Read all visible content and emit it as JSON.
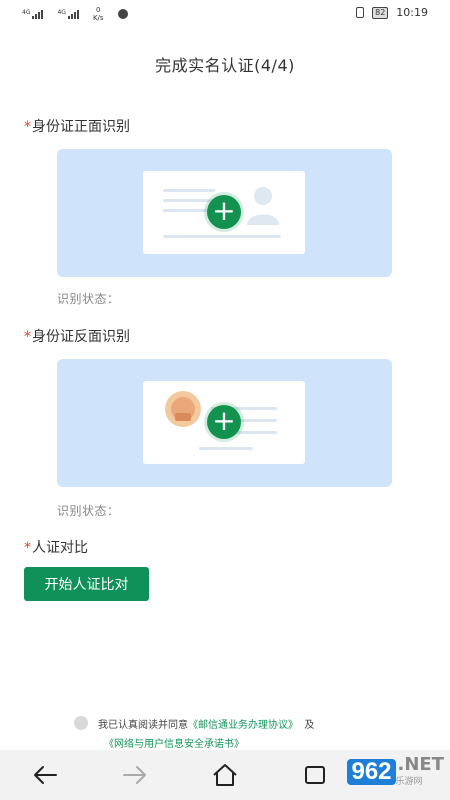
{
  "status_bar": {
    "signal1_label": "4G",
    "signal2_label": "4G",
    "speed_value": "0",
    "speed_unit": "K/s",
    "battery": "82",
    "time": "10:19"
  },
  "page": {
    "title": "完成实名认证(4/4)"
  },
  "front": {
    "star": "*",
    "label": "身份证正面识别",
    "status_label": "识别状态："
  },
  "back": {
    "star": "*",
    "label": "身份证反面识别",
    "status_label": "识别状态："
  },
  "face": {
    "star": "*",
    "label": "人证对比",
    "button_label": "开始人证比对"
  },
  "agreement": {
    "prefix": "我已认真阅读并同意",
    "link1": "《邮信通业务办理协议》",
    "joiner": "及",
    "link2": "《网络与用户信息安全承诺书》"
  },
  "nav": {
    "back_icon": "arrow-left-icon",
    "forward_icon": "arrow-right-icon",
    "home_icon": "home-icon",
    "recent_icon": "recent-apps-icon"
  },
  "watermark": {
    "logo": "962",
    "suffix": ".NET",
    "sub": "乐游网"
  },
  "colors": {
    "accent_green": "#10915a",
    "upload_bg": "#cfe4fb",
    "required_star": "#dd4422"
  }
}
